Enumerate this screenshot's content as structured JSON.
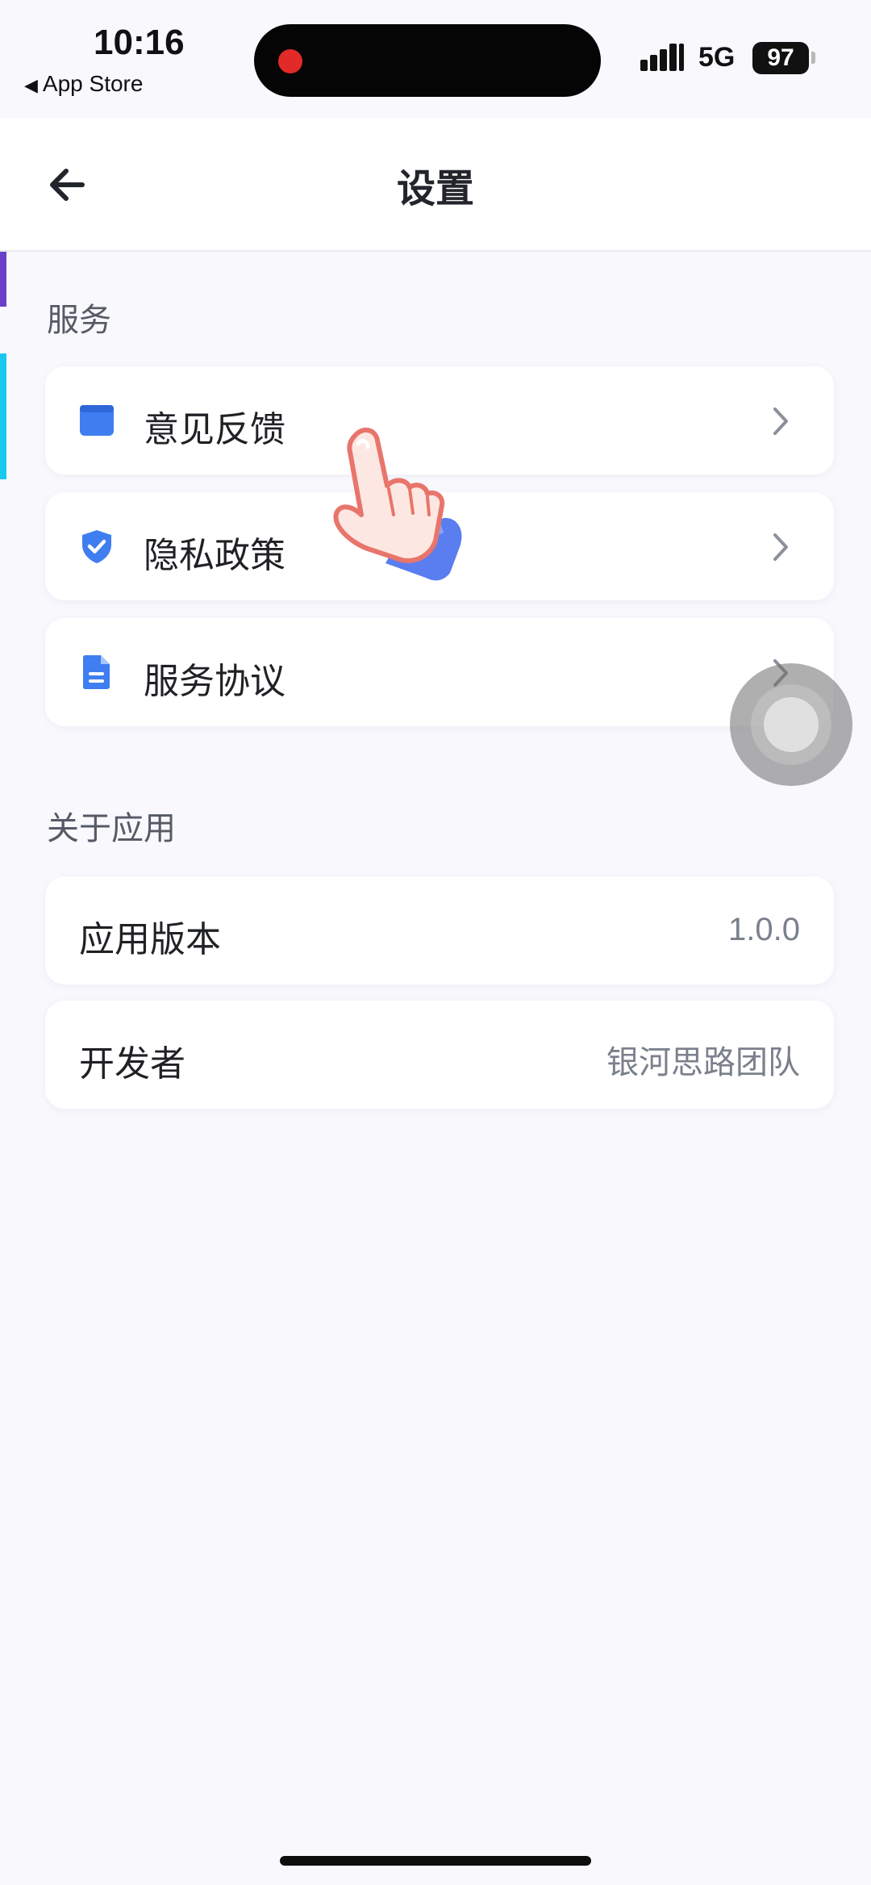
{
  "status_bar": {
    "time": "10:16",
    "back_app": "App Store",
    "network": "5G",
    "battery": "97"
  },
  "nav": {
    "title": "设置",
    "back_icon": "arrow-left-icon"
  },
  "sections": {
    "services": {
      "title": "服务",
      "items": [
        {
          "label": "意见反馈",
          "icon": "feedback-window-icon"
        },
        {
          "label": "隐私政策",
          "icon": "shield-check-icon"
        },
        {
          "label": "服务协议",
          "icon": "document-icon"
        }
      ]
    },
    "about": {
      "title": "关于应用",
      "items": [
        {
          "label": "应用版本",
          "value": "1.0.0"
        },
        {
          "label": "开发者",
          "value": "银河思路团队"
        }
      ]
    }
  },
  "colors": {
    "accent_blue": "#3f7ef0",
    "background": "#f8f8fd",
    "card": "#ffffff",
    "secondary_text": "#7a808c"
  }
}
